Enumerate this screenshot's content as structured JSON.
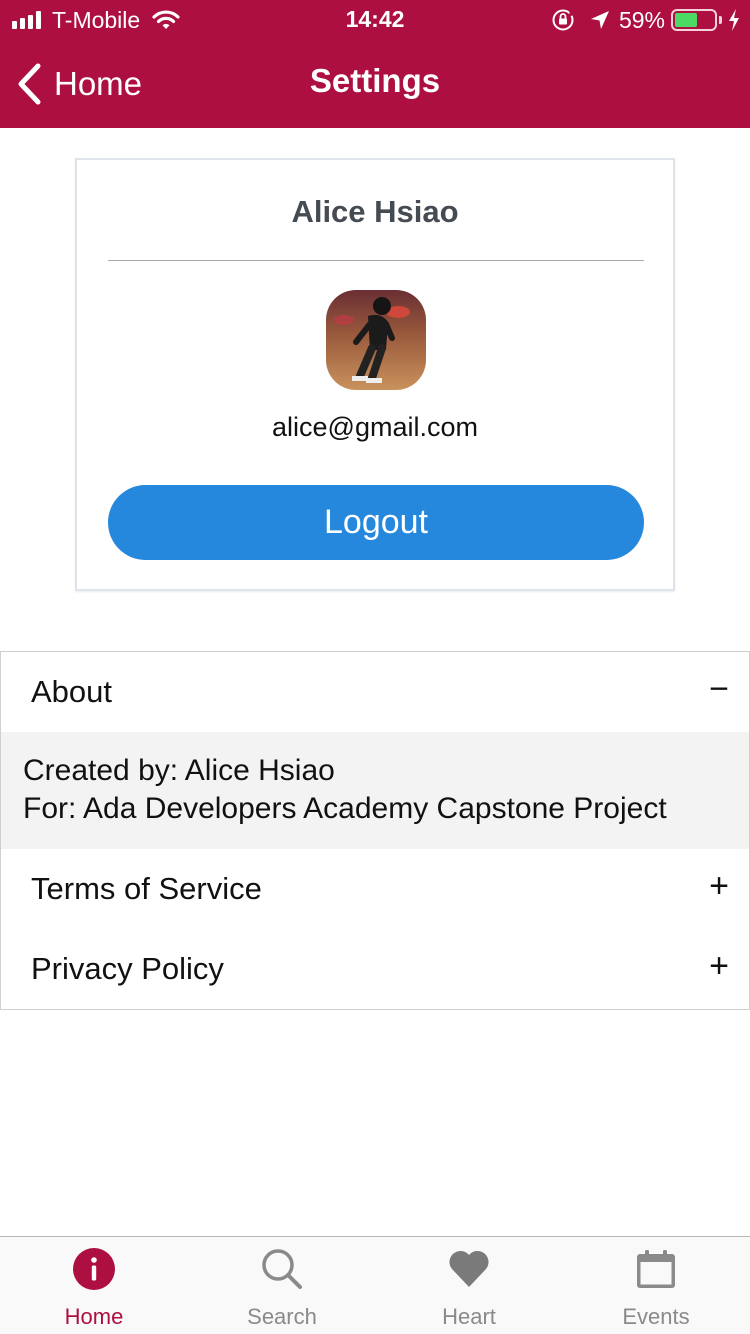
{
  "status_bar": {
    "carrier": "T-Mobile",
    "time": "14:42",
    "battery_percent": "59%",
    "battery_level": 0.59,
    "signal_bars": 4,
    "icons": [
      "signal-icon",
      "wifi-icon",
      "orientation-lock-icon",
      "location-arrow-icon",
      "battery-icon",
      "charging-bolt-icon"
    ]
  },
  "nav": {
    "back_label": "Home",
    "title": "Settings"
  },
  "profile": {
    "name": "Alice Hsiao",
    "email": "alice@gmail.com",
    "logout_label": "Logout"
  },
  "accordion": {
    "about": {
      "label": "About",
      "expanded": true,
      "toggle_symbol": "−",
      "lines": [
        "Created by: Alice Hsiao",
        "For: Ada Developers Academy Capstone Project"
      ]
    },
    "terms": {
      "label": "Terms of Service",
      "expanded": false,
      "toggle_symbol": "+"
    },
    "privacy": {
      "label": "Privacy Policy",
      "expanded": false,
      "toggle_symbol": "+"
    }
  },
  "tabs": [
    {
      "label": "Home",
      "icon": "info-icon",
      "active": true
    },
    {
      "label": "Search",
      "icon": "search-icon",
      "active": false
    },
    {
      "label": "Heart",
      "icon": "heart-icon",
      "active": false
    },
    {
      "label": "Events",
      "icon": "calendar-icon",
      "active": false
    }
  ],
  "colors": {
    "brand": "#ad1040",
    "button": "#2588dc",
    "inactive_tab": "#8a8a8a",
    "expanded_panel": "#f3f3f3"
  }
}
